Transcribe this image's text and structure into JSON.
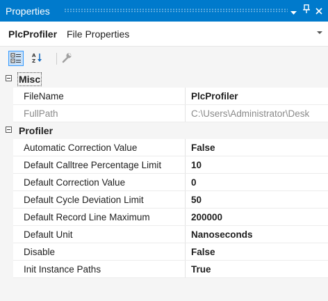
{
  "window": {
    "title": "Properties",
    "dropdown_icon": "chevron-down-icon",
    "pin_icon": "pin-icon",
    "close_icon": "close-icon"
  },
  "object_selector": {
    "name": "PlcProfiler",
    "type": "File Properties"
  },
  "toolbar": {
    "items": [
      {
        "name": "categorized-icon",
        "active": true
      },
      {
        "name": "alphabetical-icon",
        "active": false
      },
      {
        "name": "property-pages-icon",
        "active": false,
        "disabled": true
      }
    ]
  },
  "categories": [
    {
      "label": "Misc",
      "properties": [
        {
          "name": "FileName",
          "value": "PlcProfiler"
        },
        {
          "name": "FullPath",
          "value": "C:\\Users\\Administrator\\Desk",
          "readonly": true
        }
      ]
    },
    {
      "label": "Profiler",
      "properties": [
        {
          "name": "Automatic Correction Value",
          "value": "False"
        },
        {
          "name": "Default Calltree Percentage Limit",
          "value": "10"
        },
        {
          "name": "Default Correction Value",
          "value": "0"
        },
        {
          "name": "Default Cycle Deviation Limit",
          "value": "50"
        },
        {
          "name": "Default Record Line Maximum",
          "value": "200000"
        },
        {
          "name": "Default Unit",
          "value": "Nanoseconds"
        },
        {
          "name": "Disable",
          "value": "False"
        },
        {
          "name": "Init Instance Paths",
          "value": "True"
        }
      ]
    }
  ],
  "colors": {
    "titlebar": "#007acc",
    "background": "#f5f5f5",
    "selected_tool": "#c9e0f7"
  }
}
